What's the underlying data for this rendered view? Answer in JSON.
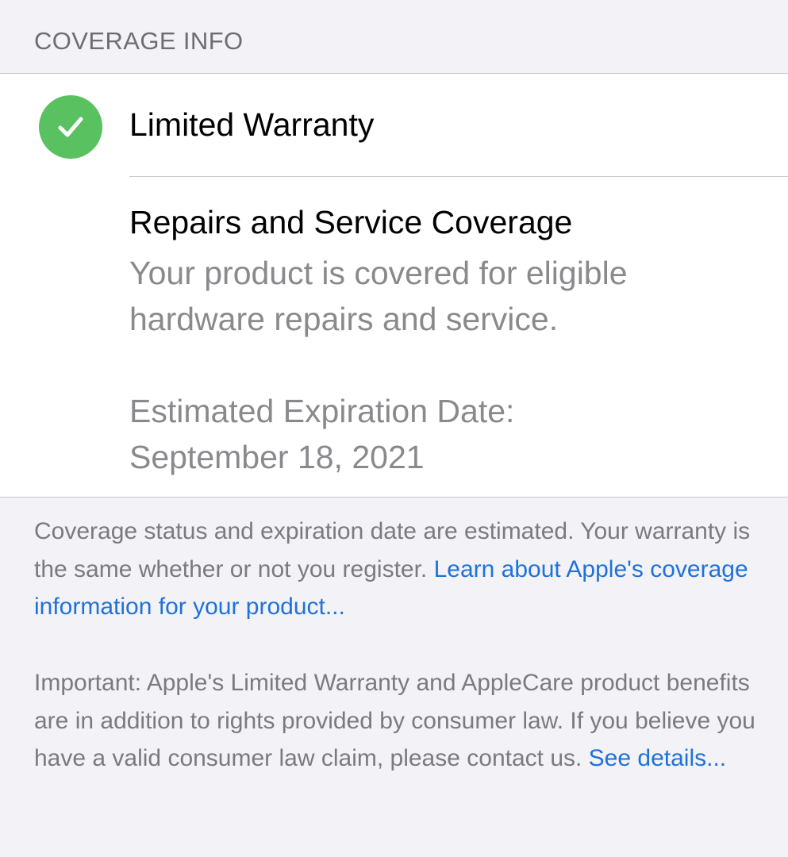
{
  "section_header": "COVERAGE INFO",
  "warranty": {
    "icon": "checkmark-circle-icon",
    "status_color": "#5ac160",
    "title": "Limited Warranty",
    "detail_title": "Repairs and Service Coverage",
    "detail_line1": "Your product is covered for eligible",
    "detail_line2": "hardware repairs and service.",
    "expiration_label": "Estimated Expiration Date:",
    "expiration_date": "September 18, 2021"
  },
  "footer": {
    "note_text": "Coverage status and expiration date are estimated. Your warranty is the same whether or not you register. ",
    "note_link": "Learn about Apple's coverage information for your product...",
    "important_text": "Important: Apple's Limited Warranty and AppleCare product benefits are in addition to rights provided by consumer law. If you believe you have a valid consumer law claim, please contact us. ",
    "important_link": "See details...",
    "link_color": "#1f72d9"
  }
}
